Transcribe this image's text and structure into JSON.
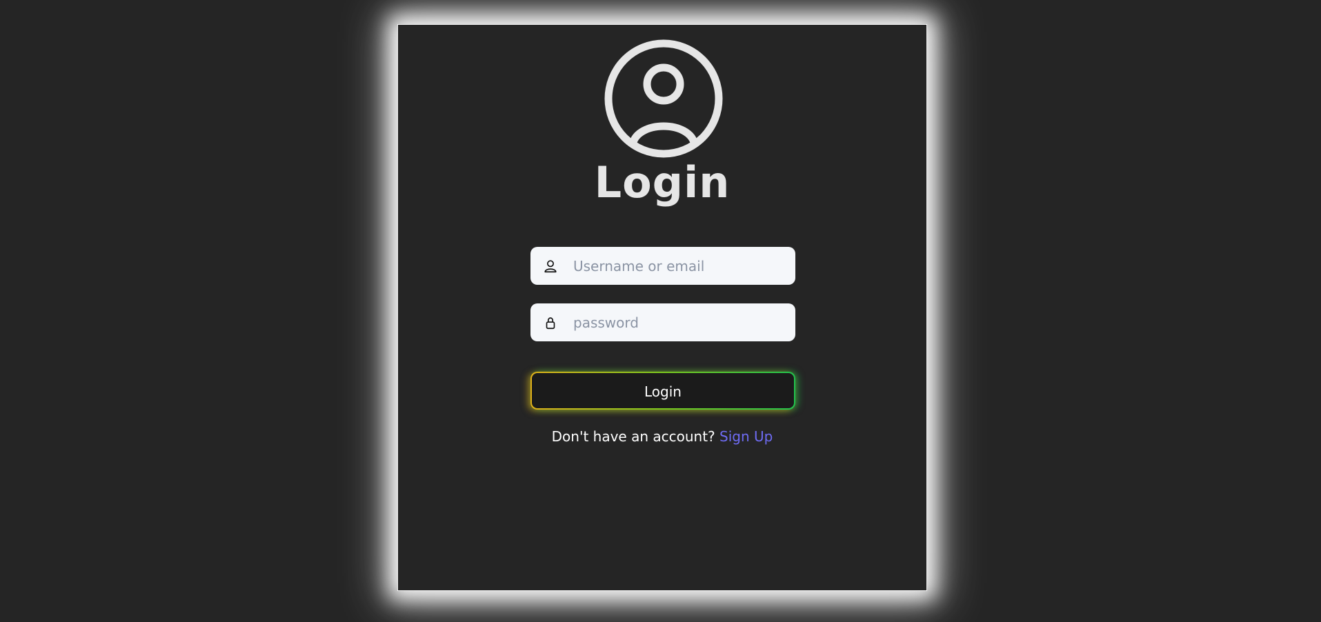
{
  "login": {
    "title": "Login",
    "username_placeholder": "Username or email",
    "username_value": "",
    "password_placeholder": "password",
    "password_value": "",
    "button_label": "Login",
    "signup_prompt": "Don't have an account?",
    "signup_link": "Sign Up"
  },
  "icons": {
    "avatar": "user-circle-icon",
    "username": "user-icon",
    "password": "lock-icon"
  },
  "colors": {
    "background": "#252525",
    "card_glow": "#ffffff",
    "title": "#e6e6e6",
    "field_bg": "#f5f7fa",
    "button_bg": "#1b1b1b",
    "button_glow_left": "#e0b21a",
    "button_glow_right": "#22c44e",
    "link": "#6f6cf5"
  }
}
